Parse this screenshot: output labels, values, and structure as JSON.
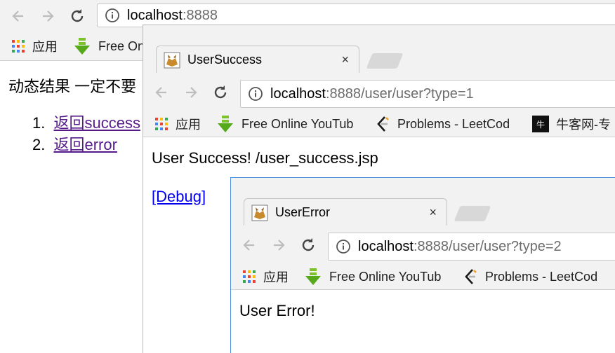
{
  "back_window": {
    "address": {
      "host": "localhost",
      "path": ":8888"
    },
    "bookmarks": {
      "apps_label": "应用",
      "item1_label": "Free On"
    },
    "content": {
      "heading": "动态结果 一定不要",
      "links": [
        {
          "num": "1.",
          "label": "返回success"
        },
        {
          "num": "2.",
          "label": "返回error"
        }
      ]
    }
  },
  "success_window": {
    "tab_title": "UserSuccess",
    "tab_close": "×",
    "address": {
      "host": "localhost",
      "path": ":8888/user/user?type=1"
    },
    "bookmarks": {
      "apps_label": "应用",
      "items": [
        "Free Online YouTub",
        "Problems - LeetCod",
        "牛客网-专"
      ]
    },
    "content": {
      "message": "User Success! /user_success.jsp",
      "debug_link": "[Debug]"
    }
  },
  "error_window": {
    "tab_title": "UserError",
    "tab_close": "×",
    "address": {
      "host": "localhost",
      "path": ":8888/user/user?type=2"
    },
    "bookmarks": {
      "apps_label": "应用",
      "items": [
        "Free Online YouTub",
        "Problems - LeetCod"
      ]
    },
    "content": {
      "message": "User Error!"
    }
  },
  "icons": {
    "back": "arrow-left-icon",
    "forward": "arrow-right-icon",
    "reload": "reload-icon",
    "info": "info-icon",
    "apps": "apps-grid-icon",
    "download": "green-arrow-bookmark-icon",
    "leetcode": "leetcode-icon",
    "nowcoder": "nowcoder-icon",
    "tomcat": "tomcat-favicon-icon"
  },
  "colors": {
    "chrome_bg": "#f2f2f2",
    "visited_link": "#551a8b",
    "link": "#0000ee",
    "url_path": "#6c6c6c",
    "active_border": "#4a90d9"
  }
}
